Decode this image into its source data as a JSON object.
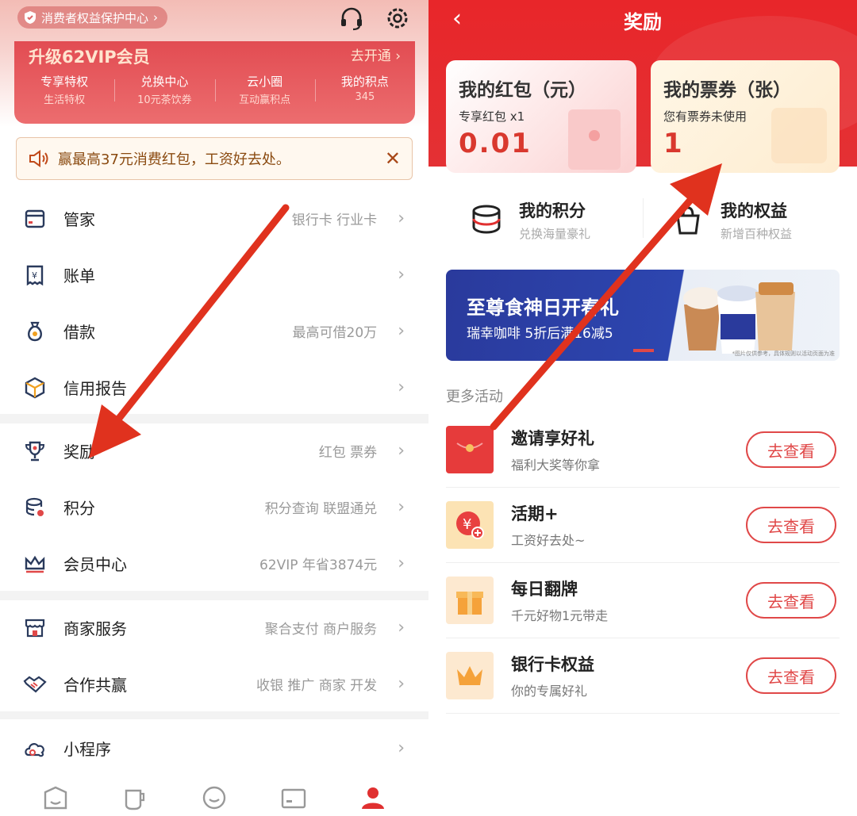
{
  "left": {
    "top_badge": "消费者权益保护中心",
    "vip": {
      "title": "升级62VIP会员",
      "open": "去开通",
      "items": [
        {
          "title": "专享特权",
          "sub": "生活特权"
        },
        {
          "title": "兑换中心",
          "sub": "10元茶饮券"
        },
        {
          "title": "云小圈",
          "sub": "互动赢积点"
        },
        {
          "title": "我的积点",
          "sub": "345"
        }
      ]
    },
    "notice": "赢最高37元消费红包，工资好去处。",
    "menu_group1": [
      {
        "label": "管家",
        "sub": "银行卡 行业卡"
      },
      {
        "label": "账单",
        "sub": ""
      },
      {
        "label": "借款",
        "sub": "最高可借20万"
      },
      {
        "label": "信用报告",
        "sub": ""
      }
    ],
    "menu_group2": [
      {
        "label": "奖励",
        "sub": "红包 票券"
      },
      {
        "label": "积分",
        "sub": "积分查询 联盟通兑"
      },
      {
        "label": "会员中心",
        "sub": "62VIP 年省3874元"
      }
    ],
    "menu_group3": [
      {
        "label": "商家服务",
        "sub": "聚合支付 商户服务"
      },
      {
        "label": "合作共赢",
        "sub": "收银 推广 商家 开发"
      }
    ],
    "menu_group4": [
      {
        "label": "小程序",
        "sub": ""
      }
    ]
  },
  "right": {
    "title": "奖励",
    "redpacket": {
      "title": "我的红包（元）",
      "desc": "专享红包 x1",
      "value": "0.01"
    },
    "ticket": {
      "title": "我的票券（张）",
      "desc": "您有票券未使用",
      "value": "1"
    },
    "points": {
      "title": "我的积分",
      "sub": "兑换海量豪礼"
    },
    "rights": {
      "title": "我的权益",
      "sub": "新增百种权益"
    },
    "banner": {
      "title": "至尊食神日开春礼",
      "sub": "瑞幸咖啡 5折后满16减5",
      "fine": "*图片仅供参考，具体规则以活动页面为准"
    },
    "more_label": "更多活动",
    "activities": [
      {
        "title": "邀请享好礼",
        "sub": "福利大奖等你拿",
        "button": "去查看"
      },
      {
        "title": "活期+",
        "sub": "工资好去处~",
        "button": "去查看"
      },
      {
        "title": "每日翻牌",
        "sub": "千元好物1元带走",
        "button": "去查看"
      },
      {
        "title": "银行卡权益",
        "sub": "你的专属好礼",
        "button": "去查看"
      }
    ]
  },
  "colors": {
    "brand_red": "#e8262a",
    "arrow": "#e0321e",
    "button_red": "#e04848"
  }
}
